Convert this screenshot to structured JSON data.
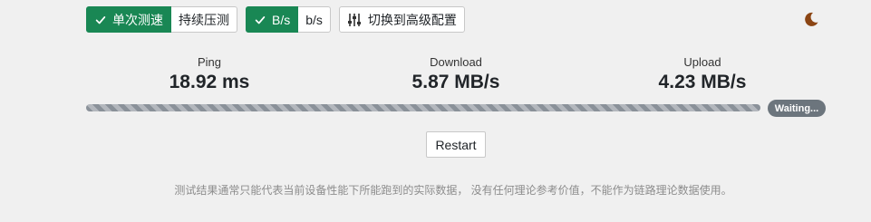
{
  "toolbar": {
    "mode": {
      "single_label": "单次测速",
      "continuous_label": "持续压测",
      "selected": "single"
    },
    "unit": {
      "bytes_label": "B/s",
      "bits_label": "b/s",
      "selected": "bytes"
    },
    "advanced_label": "切换到高级配置",
    "icons": {
      "check": "check-icon",
      "advanced": "sliders-icon",
      "theme": "moon-icon"
    }
  },
  "metrics": {
    "ping": {
      "label": "Ping",
      "value": "18.92 ms"
    },
    "download": {
      "label": "Download",
      "value": "5.87 MB/s"
    },
    "upload": {
      "label": "Upload",
      "value": "4.23 MB/s"
    }
  },
  "progress": {
    "status": "Waiting...",
    "fraction": 1.0
  },
  "restart_label": "Restart",
  "disclaimer": "测试结果通常只能代表当前设备性能下所能跑到的实际数据， 没有任何理论参考价值，不能作为链路理论数据使用。",
  "colors": {
    "accent": "#198754",
    "badge": "#6c757d",
    "moon": "#8b4513",
    "progress_bar": "#8a9199"
  }
}
